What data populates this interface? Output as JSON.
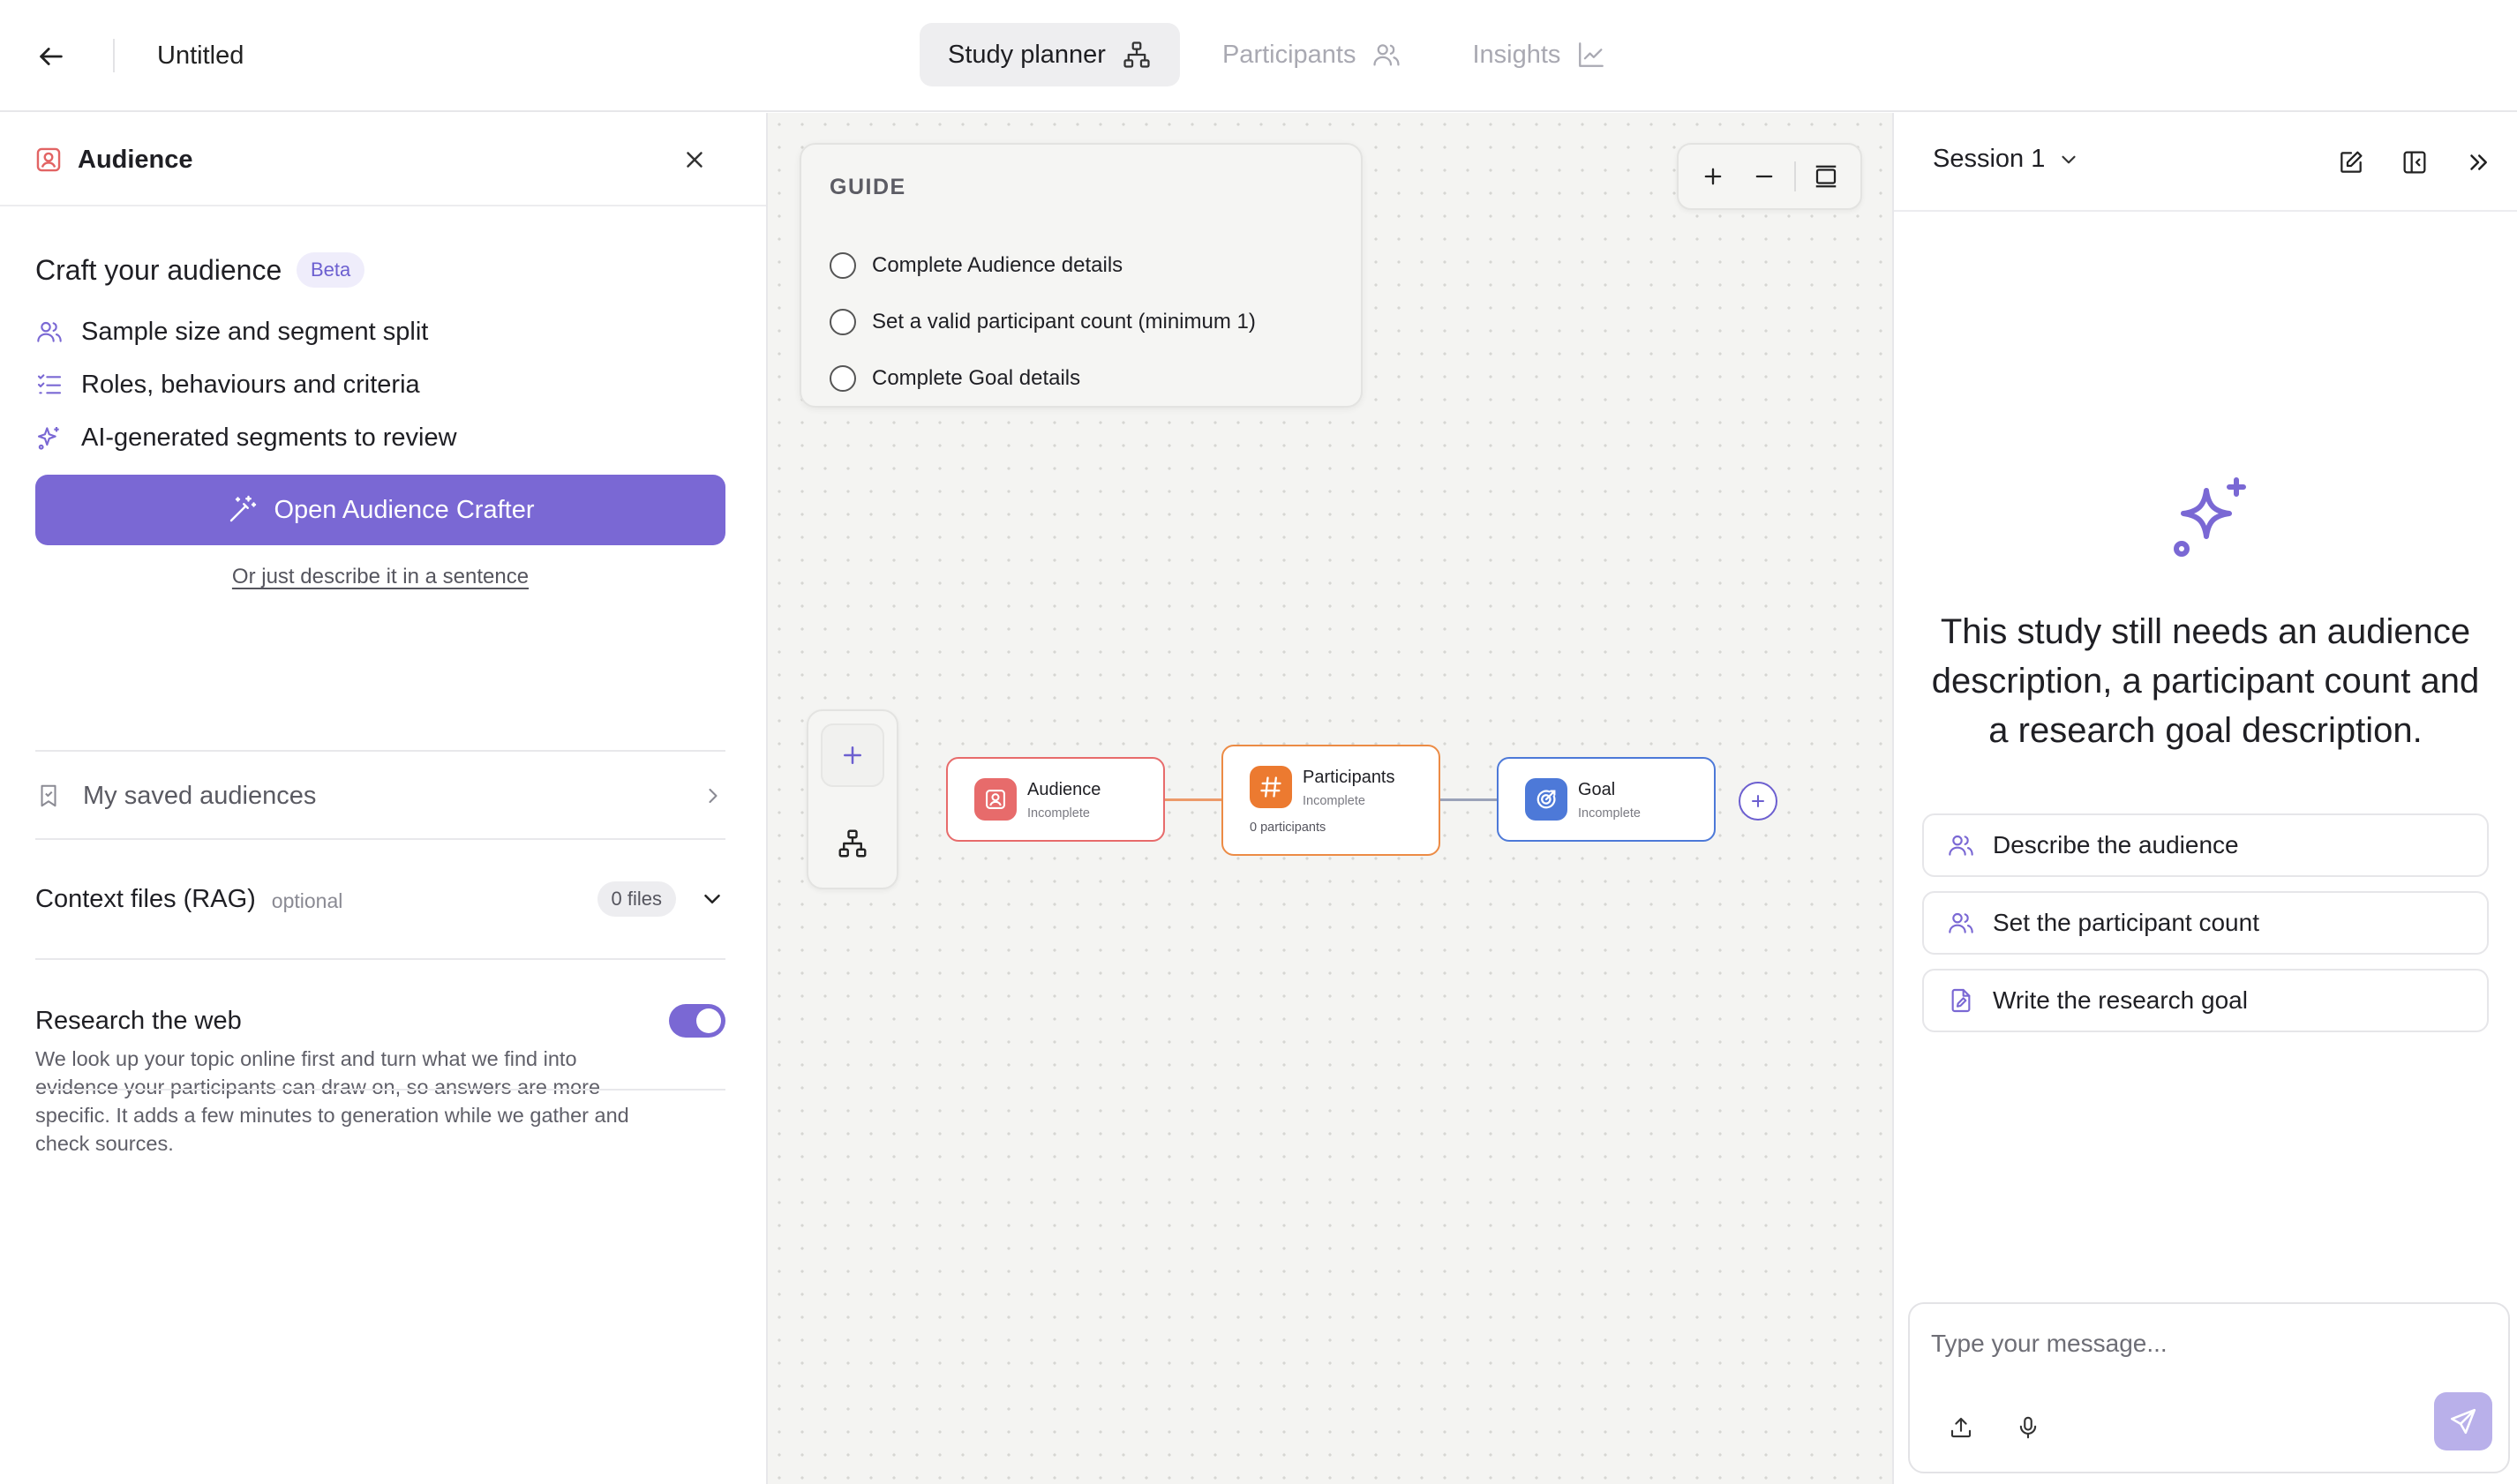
{
  "header": {
    "back_icon": "arrow-left-icon",
    "title": "Untitled",
    "tabs": [
      {
        "label": "Study planner",
        "icon": "sitemap-icon",
        "active": true
      },
      {
        "label": "Participants",
        "icon": "users-icon",
        "active": false
      },
      {
        "label": "Insights",
        "icon": "line-chart-icon",
        "active": false
      }
    ]
  },
  "left_panel": {
    "title": "Audience",
    "craft_title": "Craft your audience",
    "beta_badge": "Beta",
    "features": [
      {
        "label": "Sample size and segment split",
        "icon": "users-icon"
      },
      {
        "label": "Roles, behaviours and criteria",
        "icon": "checklist-icon"
      },
      {
        "label": "AI-generated segments to review",
        "icon": "sparkles-icon"
      }
    ],
    "primary_button": "Open Audience Crafter",
    "describe_link": "Or just describe it in a sentence",
    "saved_audiences": "My saved audiences",
    "context_files": {
      "label": "Context files (RAG)",
      "optional": "optional",
      "count": "0 files"
    },
    "research_web": {
      "title": "Research the web",
      "description": "We look up your topic online first and turn what we find into evidence your participants can draw on, so answers are more specific. It adds a few minutes to generation while we gather and check sources.",
      "enabled": true
    }
  },
  "canvas": {
    "guide": {
      "title": "GUIDE",
      "items": [
        "Complete Audience details",
        "Set a valid participant count (minimum 1)",
        "Complete Goal details"
      ]
    },
    "nodes": {
      "audience": {
        "title": "Audience",
        "status": "Incomplete",
        "color": "#e76b6b"
      },
      "participants": {
        "title": "Participants",
        "status": "Incomplete",
        "footer": "0 participants",
        "color": "#ec8b45"
      },
      "goal": {
        "title": "Goal",
        "status": "Incomplete",
        "color": "#4d79d8"
      }
    }
  },
  "right_panel": {
    "session": "Session 1",
    "message": "This study still needs an audience description, a participant count and a research goal description.",
    "suggestions": [
      {
        "label": "Describe the audience",
        "icon": "users-icon"
      },
      {
        "label": "Set the participant count",
        "icon": "users-icon"
      },
      {
        "label": "Write the research goal",
        "icon": "file-edit-icon"
      }
    ],
    "composer": {
      "placeholder": "Type your message..."
    }
  },
  "colors": {
    "accent": "#7a68d4",
    "audience": "#e76b6b",
    "participants": "#ec8b45",
    "goal": "#4d79d8"
  }
}
